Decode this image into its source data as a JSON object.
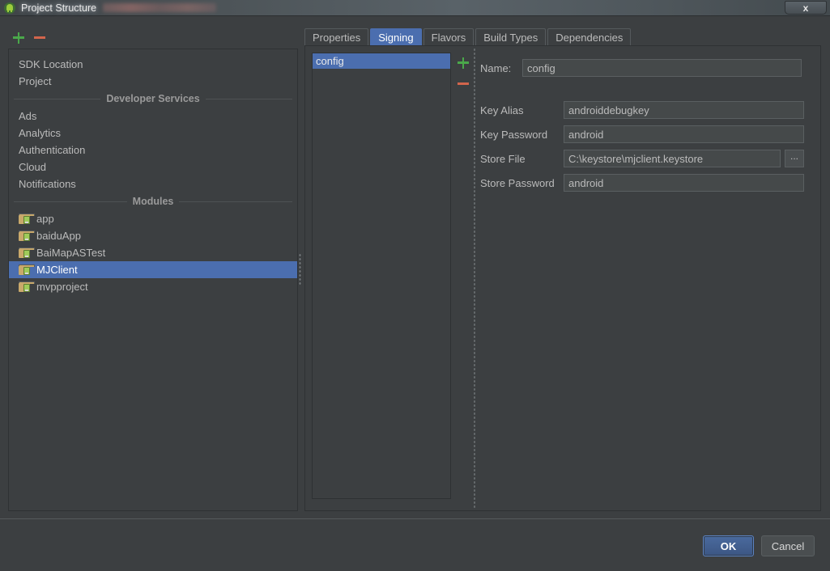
{
  "window": {
    "title": "Project Structure",
    "title_icon": "android-studio-icon",
    "redacted_suffix": true,
    "close_label": "x"
  },
  "left_toolbar": {
    "add_label": "+",
    "remove_label": "−"
  },
  "sidebar": {
    "top_items": [
      {
        "label": "SDK Location"
      },
      {
        "label": "Project"
      }
    ],
    "groups": [
      {
        "title": "Developer Services",
        "items": [
          {
            "label": "Ads"
          },
          {
            "label": "Analytics"
          },
          {
            "label": "Authentication"
          },
          {
            "label": "Cloud"
          },
          {
            "label": "Notifications"
          }
        ]
      }
    ],
    "modules_title": "Modules",
    "modules": [
      {
        "label": "app",
        "selected": false,
        "icon": "module-android-icon"
      },
      {
        "label": "baiduApp",
        "selected": false,
        "icon": "module-android-icon"
      },
      {
        "label": "BaiMapASTest",
        "selected": false,
        "icon": "module-android-icon"
      },
      {
        "label": "MJClient",
        "selected": true,
        "icon": "module-android-icon"
      },
      {
        "label": "mvpproject",
        "selected": false,
        "icon": "module-android-icon"
      }
    ]
  },
  "tabs": [
    {
      "label": "Properties",
      "active": false
    },
    {
      "label": "Signing",
      "active": true
    },
    {
      "label": "Flavors",
      "active": false
    },
    {
      "label": "Build Types",
      "active": false
    },
    {
      "label": "Dependencies",
      "active": false
    }
  ],
  "signing": {
    "config_list": [
      {
        "label": "config",
        "selected": true
      }
    ],
    "list_tools": {
      "add_label": "+",
      "remove_label": "−"
    },
    "fields": {
      "name_label": "Name:",
      "name_value": "config",
      "key_alias_label": "Key Alias",
      "key_alias_value": "androiddebugkey",
      "key_password_label": "Key Password",
      "key_password_value": "android",
      "store_file_label": "Store File",
      "store_file_value": "C:\\keystore\\mjclient.keystore",
      "store_file_browse_label": "...",
      "store_password_label": "Store Password",
      "store_password_value": "android"
    }
  },
  "footer": {
    "ok_label": "OK",
    "cancel_label": "Cancel"
  },
  "colors": {
    "background": "#3c3f41",
    "accent_blue": "#4b6eaf",
    "field_background": "#45494a",
    "text": "#bbbbbb",
    "add_green": "#4aa84a",
    "remove_red": "#d2654c",
    "module_icon_folder": "#c9a96b",
    "module_icon_android": "#9fcb5a"
  }
}
